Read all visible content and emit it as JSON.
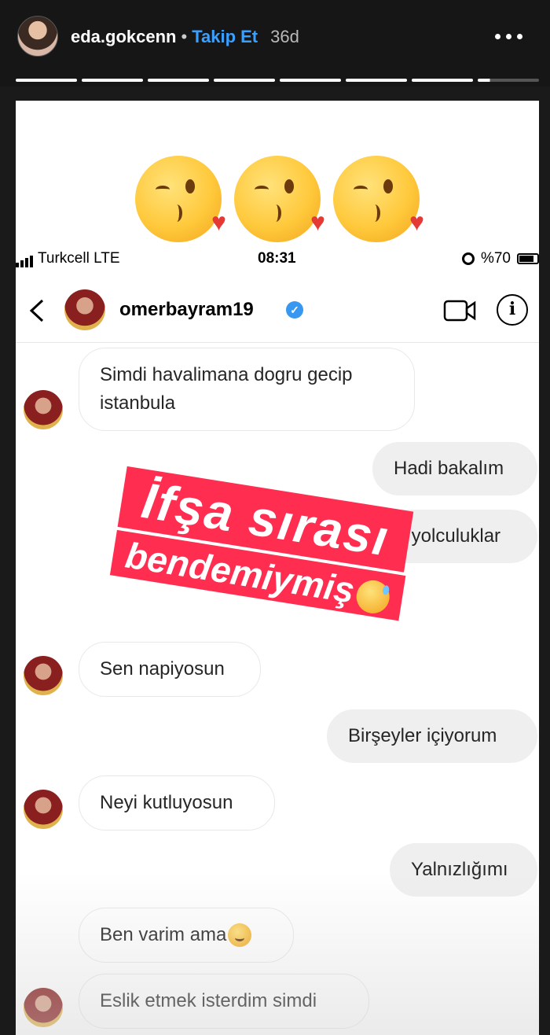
{
  "story": {
    "username": "eda.gokcenn",
    "separator": "•",
    "follow_label": "Takip Et",
    "age": "36d",
    "progress_segments": 8
  },
  "status_bar": {
    "carrier": "Turkcell LTE",
    "time": "08:31",
    "battery": "%70"
  },
  "dm": {
    "username": "omerbayram19",
    "verified_mark": "✓"
  },
  "messages": [
    {
      "direction": "in",
      "text_line1": "Simdi havalimana dogru gecip",
      "text_line2": "istanbula"
    },
    {
      "direction": "out",
      "text": "Hadi bakalım"
    },
    {
      "direction": "out",
      "text": "İyi yolculuklar"
    },
    {
      "direction": "in",
      "text": "Sen napiyosun"
    },
    {
      "direction": "out",
      "text": "Birşeyler içiyorum"
    },
    {
      "direction": "in",
      "text": "Neyi kutluyosun"
    },
    {
      "direction": "out",
      "text": "Yalnızlığımı"
    },
    {
      "direction": "in",
      "text": "Ben varim ama"
    },
    {
      "direction": "in",
      "text": "Eslik etmek isterdim simdi"
    }
  ],
  "sticker": {
    "line1": "İfşa sırası",
    "line2": "bendemiymiş"
  },
  "colors": {
    "follow": "#3aa0ff",
    "sticker_bg": "#ff2e50",
    "verified": "#3897f0",
    "bubble_out": "#efefef"
  },
  "icons": [
    "more-icon",
    "back-icon",
    "verified-icon",
    "video-call-icon",
    "info-icon",
    "kiss-emoji",
    "hug-emoji",
    "sweat-smile-emoji"
  ]
}
